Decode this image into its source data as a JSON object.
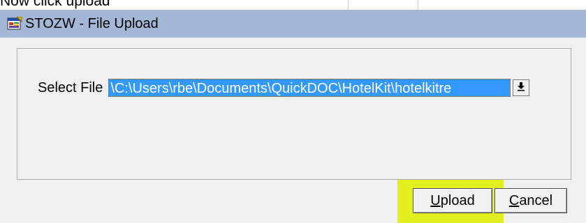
{
  "top_text": "Now click upload",
  "window": {
    "title": "STOZW - File Upload",
    "icon": "app-window-icon"
  },
  "form": {
    "select_file_label": "Select File",
    "file_path_value": "\\C:\\Users\\rbe\\Documents\\QuickDOC\\HotelKit\\hotelkitre",
    "browse_icon": "dropdown-arrow-icon"
  },
  "buttons": {
    "upload_first": "U",
    "upload_rest": "pload",
    "cancel_first": "C",
    "cancel_rest": "ancel"
  },
  "colors": {
    "titlebar": "#a2b8d6",
    "selection": "#3399ff",
    "highlight": "#e4ef1f"
  }
}
